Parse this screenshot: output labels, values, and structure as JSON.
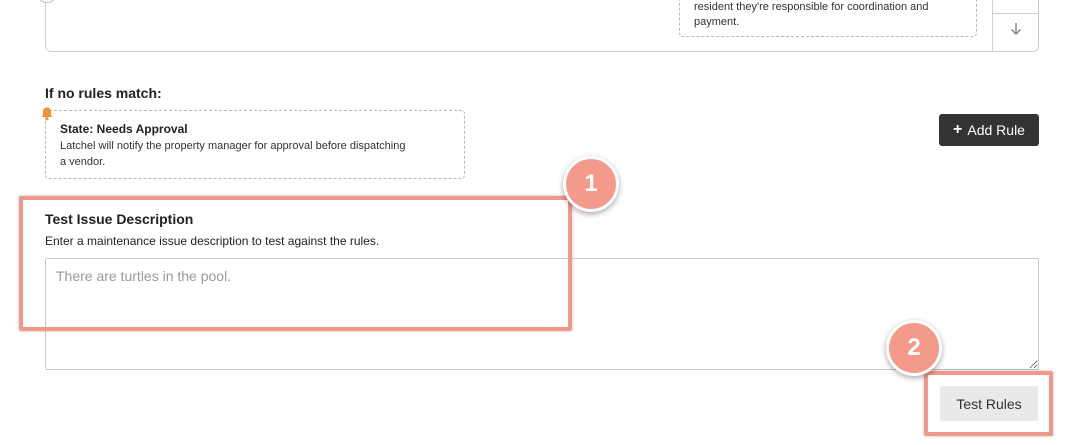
{
  "rule_card": {
    "note_line1": "resident they're responsible for coordination and",
    "note_line2": "payment."
  },
  "no_match": {
    "heading": "If no rules match:",
    "state_title": "State: Needs Approval",
    "state_desc_line1": "Latchel will notify the property manager for approval before dispatching",
    "state_desc_line2": "a vendor."
  },
  "toolbar": {
    "add_rule_label": "Add Rule"
  },
  "test": {
    "heading": "Test Issue Description",
    "description": "Enter a maintenance issue description to test against the rules.",
    "placeholder": "There are turtles in the pool.",
    "value": "",
    "test_rules_label": "Test Rules"
  },
  "annotations": {
    "step1": "1",
    "step2": "2",
    "highlight_color": "#f2988a"
  },
  "icons": {
    "bell": "bell-icon",
    "plus": "plus-icon",
    "down_arrow": "arrow-down-icon"
  }
}
